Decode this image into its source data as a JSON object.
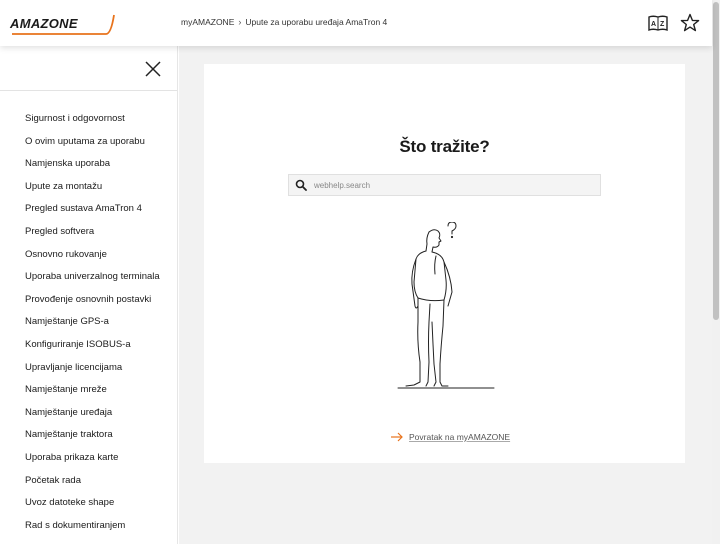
{
  "header": {
    "logo_text": "AMAZONE",
    "breadcrumb": [
      "myAMAZONE",
      "Upute za uporabu uređaja AmaTron 4"
    ],
    "breadcrumb_separator": "›",
    "az_icon": "az-glossary-icon",
    "star_icon": "star-icon",
    "accent_color": "#e8731c"
  },
  "sidebar": {
    "close_icon": "close-icon",
    "items": [
      {
        "label": "Sigurnost i odgovornost"
      },
      {
        "label": "O ovim uputama za uporabu"
      },
      {
        "label": "Namjenska uporaba"
      },
      {
        "label": "Upute za montažu"
      },
      {
        "label": "Pregled sustava AmaTron 4"
      },
      {
        "label": "Pregled softvera"
      },
      {
        "label": "Osnovno rukovanje"
      },
      {
        "label": "Uporaba univerzalnog terminala"
      },
      {
        "label": "Provođenje osnovnih postavki"
      },
      {
        "label": "Namještanje GPS-a"
      },
      {
        "label": "Konfiguriranje ISOBUS-a"
      },
      {
        "label": "Upravljanje licencijama"
      },
      {
        "label": "Namještanje mreže"
      },
      {
        "label": "Namještanje uređaja"
      },
      {
        "label": "Namještanje traktora"
      },
      {
        "label": "Uporaba prikaza karte"
      },
      {
        "label": "Početak rada"
      },
      {
        "label": "Uvoz datoteke shape"
      },
      {
        "label": "Rad s dokumentiranjem"
      }
    ]
  },
  "main": {
    "title": "Što tražite?",
    "search": {
      "placeholder": "webhelp.search",
      "value": "",
      "icon": "search-icon"
    },
    "illustration": "thinking-man-illustration",
    "back_link": "Povratak na myAMAZONE",
    "back_icon": "arrow-right-icon"
  }
}
